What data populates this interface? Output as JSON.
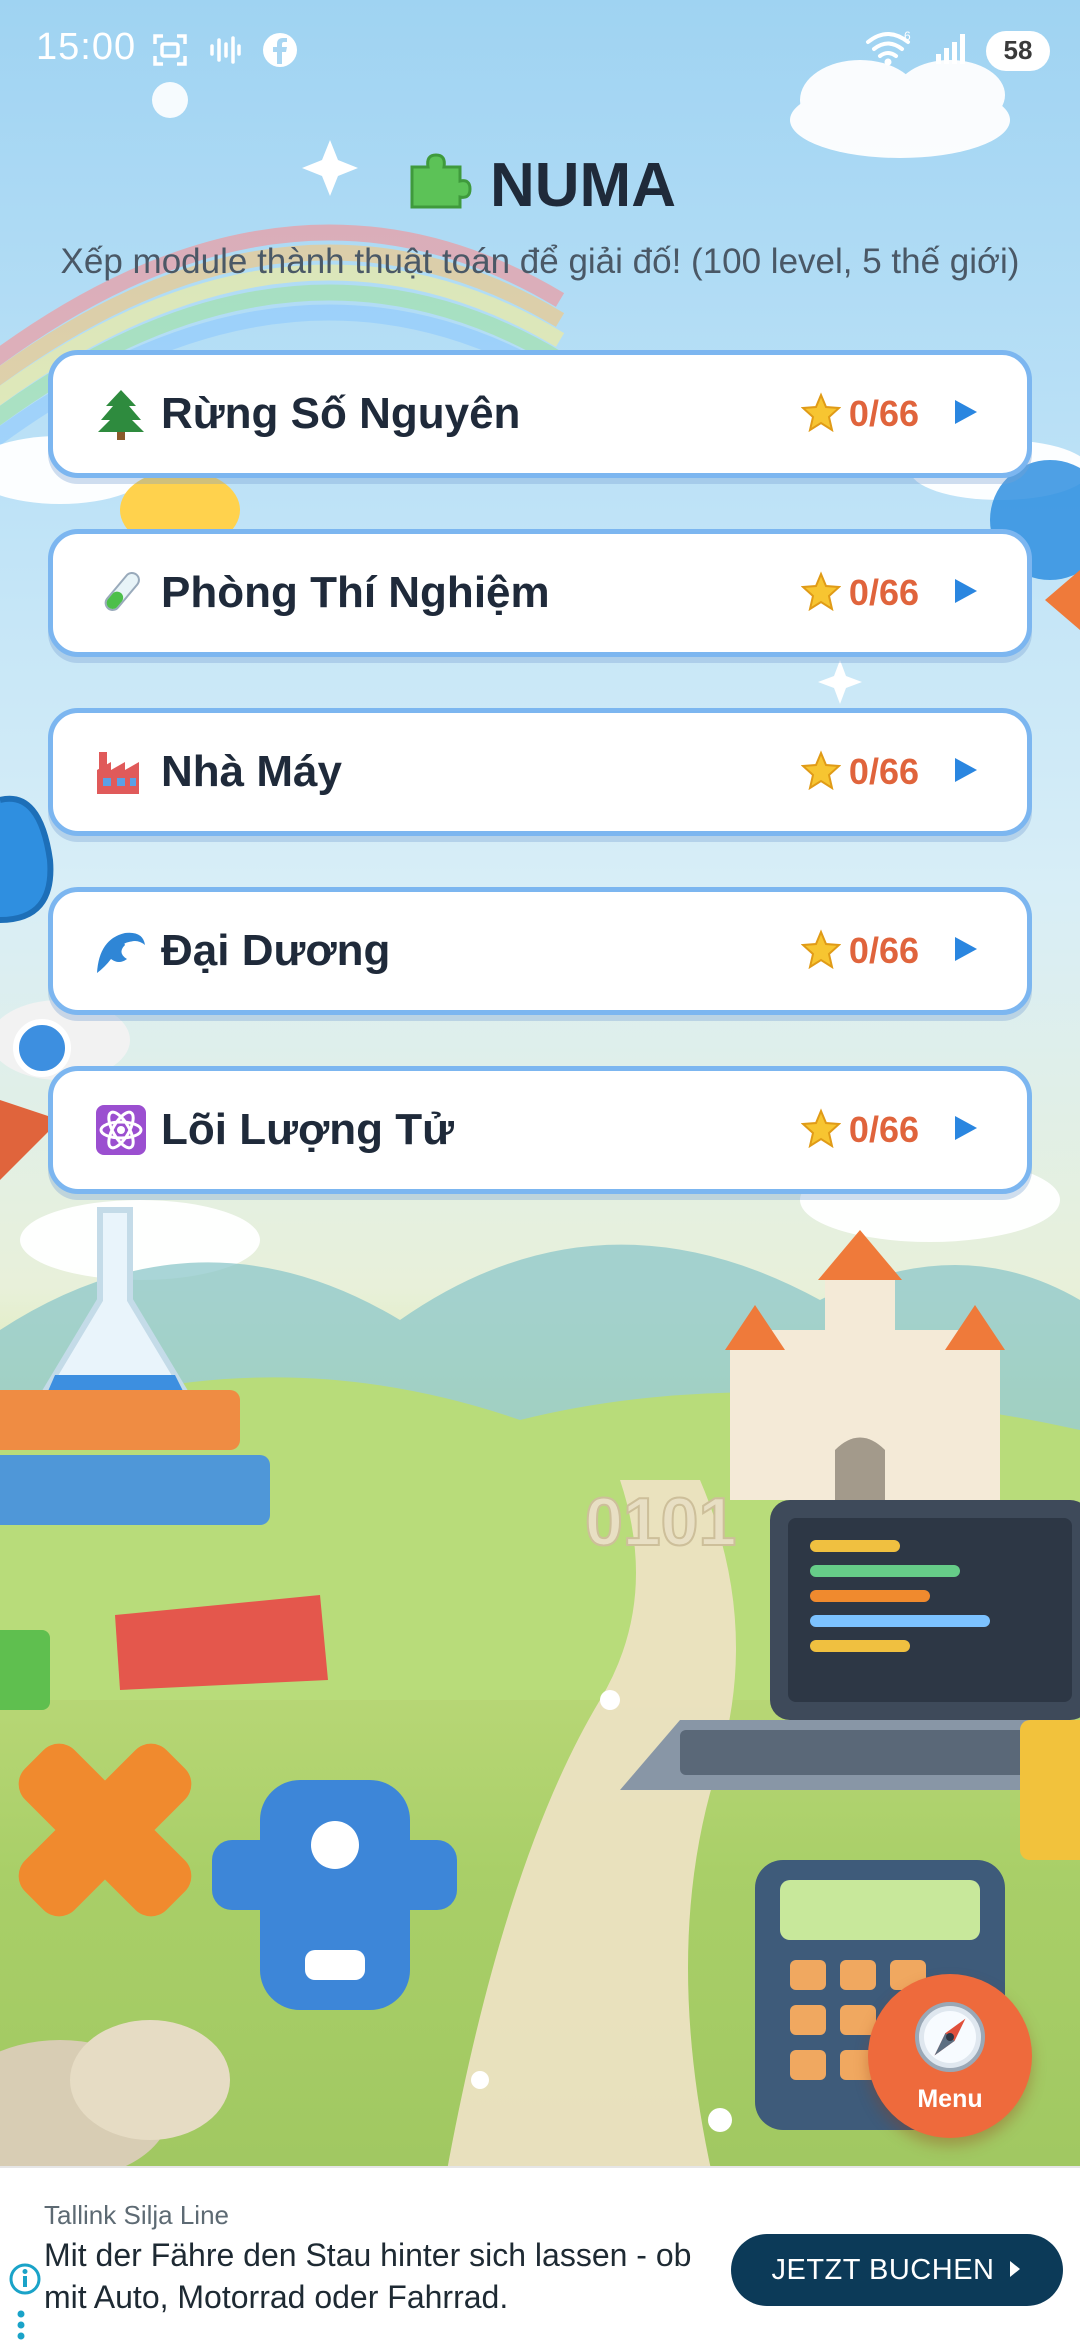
{
  "status_bar": {
    "time": "15:00",
    "battery": "58",
    "network_label": "6",
    "icons_left": [
      "screenshot-icon",
      "voice-icon",
      "facebook-icon"
    ],
    "icons_right": [
      "wifi-icon",
      "signal-icon",
      "battery-icon"
    ]
  },
  "header": {
    "title": "NUMA",
    "title_icon": "puzzle-icon",
    "subtitle": "Xếp module thành thuật toán để giải đố! (100 level, 5 thế giới)"
  },
  "worlds": [
    {
      "name": "Rừng Số Nguyên",
      "icon": "tree-icon",
      "score": "0/66"
    },
    {
      "name": "Phòng Thí Nghiệm",
      "icon": "test-tube-icon",
      "score": "0/66"
    },
    {
      "name": "Nhà Máy",
      "icon": "factory-icon",
      "score": "0/66"
    },
    {
      "name": "Đại Dương",
      "icon": "wave-icon",
      "score": "0/66"
    },
    {
      "name": "Lõi Lượng Tử",
      "icon": "atom-icon",
      "score": "0/66"
    }
  ],
  "background_text": "0101",
  "menu": {
    "label": "Menu",
    "icon": "compass-icon"
  },
  "ad": {
    "advertiser": "Tallink Silja Line",
    "text": "Mit der Fähre den Stau hinter sich lassen - ob mit Auto, Motorrad oder Fahrrad.",
    "cta": "JETZT BUCHEN"
  },
  "colors": {
    "card_border": "#7cb6f0",
    "score": "#e0643c",
    "arrow": "#2a86e0",
    "menu_button": "#ee6a3c",
    "ad_button": "#0c3a58"
  }
}
